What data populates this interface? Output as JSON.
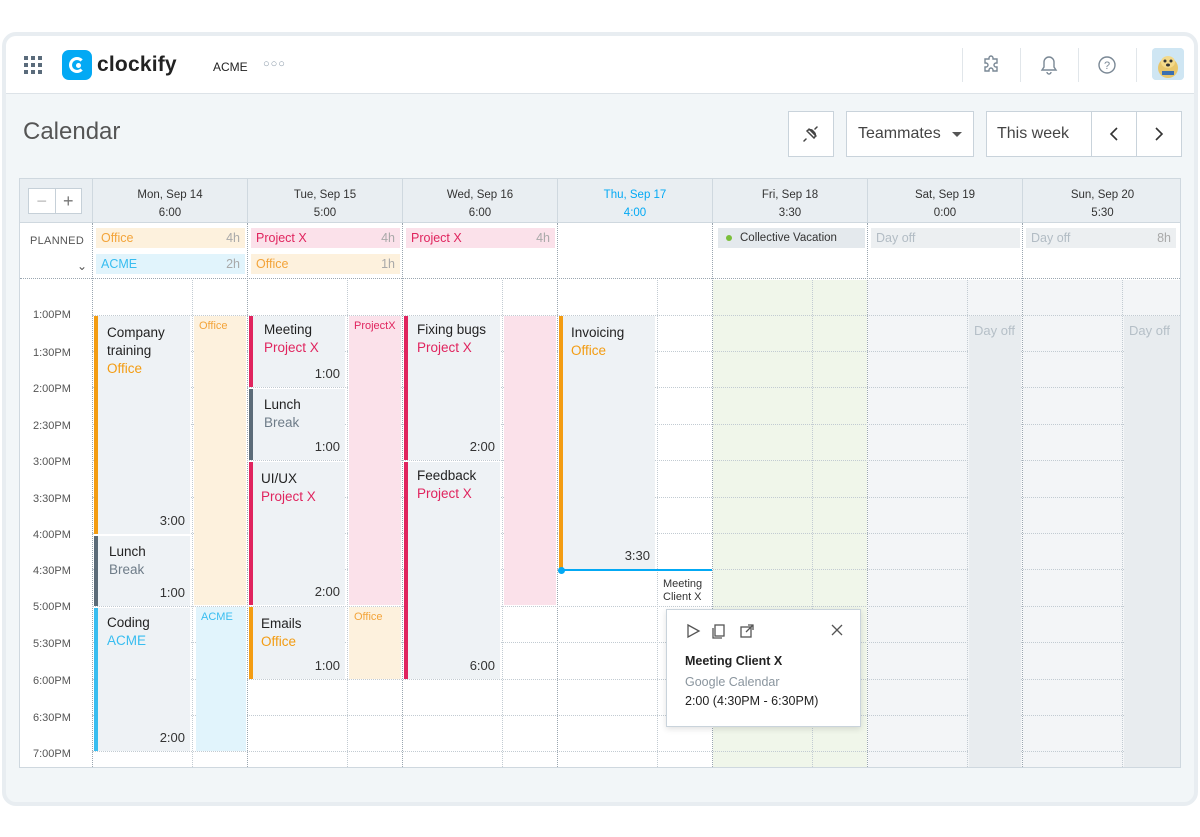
{
  "app": {
    "brand": "clockify",
    "workspace": "ACME",
    "more": "○○○"
  },
  "header_icons": [
    "puzzle-icon",
    "bell-icon",
    "help-icon"
  ],
  "page": {
    "title": "Calendar"
  },
  "controls": {
    "teammates": "Teammates",
    "range": "This week"
  },
  "columns": [
    {
      "day": "Mon, Sep 14",
      "total": "6:00",
      "today": false
    },
    {
      "day": "Tue, Sep 15",
      "total": "5:00",
      "today": false
    },
    {
      "day": "Wed, Sep 16",
      "total": "6:00",
      "today": false
    },
    {
      "day": "Thu, Sep 17",
      "total": "4:00",
      "today": true
    },
    {
      "day": "Fri, Sep 18",
      "total": "3:30",
      "today": false
    },
    {
      "day": "Sat, Sep 19",
      "total": "0:00",
      "today": false
    },
    {
      "day": "Sun, Sep 20",
      "total": "5:30",
      "today": false
    }
  ],
  "planned": {
    "label": "PLANNED",
    "bars": [
      {
        "name": "Office",
        "hours": "4h"
      },
      {
        "name": "ACME",
        "hours": "2h"
      },
      {
        "name": "Project X",
        "hours": "4h"
      },
      {
        "name": "Office",
        "hours": "1h"
      },
      {
        "name": "Project X",
        "hours": "4h"
      },
      {
        "name": "Collective Vacation",
        "hours": ""
      },
      {
        "name": "Day off",
        "hours": ""
      },
      {
        "name": "Day off",
        "hours": "8h"
      }
    ]
  },
  "times": [
    "1:00PM",
    "1:30PM",
    "2:00PM",
    "2:30PM",
    "3:00PM",
    "3:30PM",
    "4:00PM",
    "4:30PM",
    "5:00PM",
    "5:30PM",
    "6:00PM",
    "6:30PM",
    "7:00PM"
  ],
  "events": [
    {
      "title": "Company training",
      "project": "Office",
      "duration": "3:00"
    },
    {
      "title": "Lunch",
      "project": "Break",
      "duration": "1:00"
    },
    {
      "title": "Coding",
      "project": "ACME",
      "duration": "2:00"
    },
    {
      "title": "Meeting",
      "project": "Project X",
      "duration": "1:00"
    },
    {
      "title": "Lunch",
      "project": "Break",
      "duration": "1:00"
    },
    {
      "title": "UI/UX",
      "project": "Project X",
      "duration": "2:00"
    },
    {
      "title": "Emails",
      "project": "Office",
      "duration": "1:00"
    },
    {
      "title": "Fixing bugs",
      "project": "Project X",
      "duration": "2:00"
    },
    {
      "title": "Feedback",
      "project": "Project X",
      "duration": "6:00"
    },
    {
      "title": "Invoicing",
      "project": "Office",
      "duration": "3:30"
    }
  ],
  "plan_blocks": [
    "Office",
    "ACME",
    "ProjectX",
    "Office"
  ],
  "dayoff_blocks": [
    "Day off",
    "Day off"
  ],
  "mini_event": {
    "line1": "Meeting",
    "line2": "Client X"
  },
  "popup": {
    "title": "Meeting Client X",
    "source": "Google Calendar",
    "time": "2:00 (4:30PM - 6:30PM)"
  },
  "colors": {
    "office": "#f39c12",
    "project_x": "#e0245e",
    "acme": "#38bdf0",
    "break": "#5b6b78",
    "accent": "#03a9f4"
  }
}
